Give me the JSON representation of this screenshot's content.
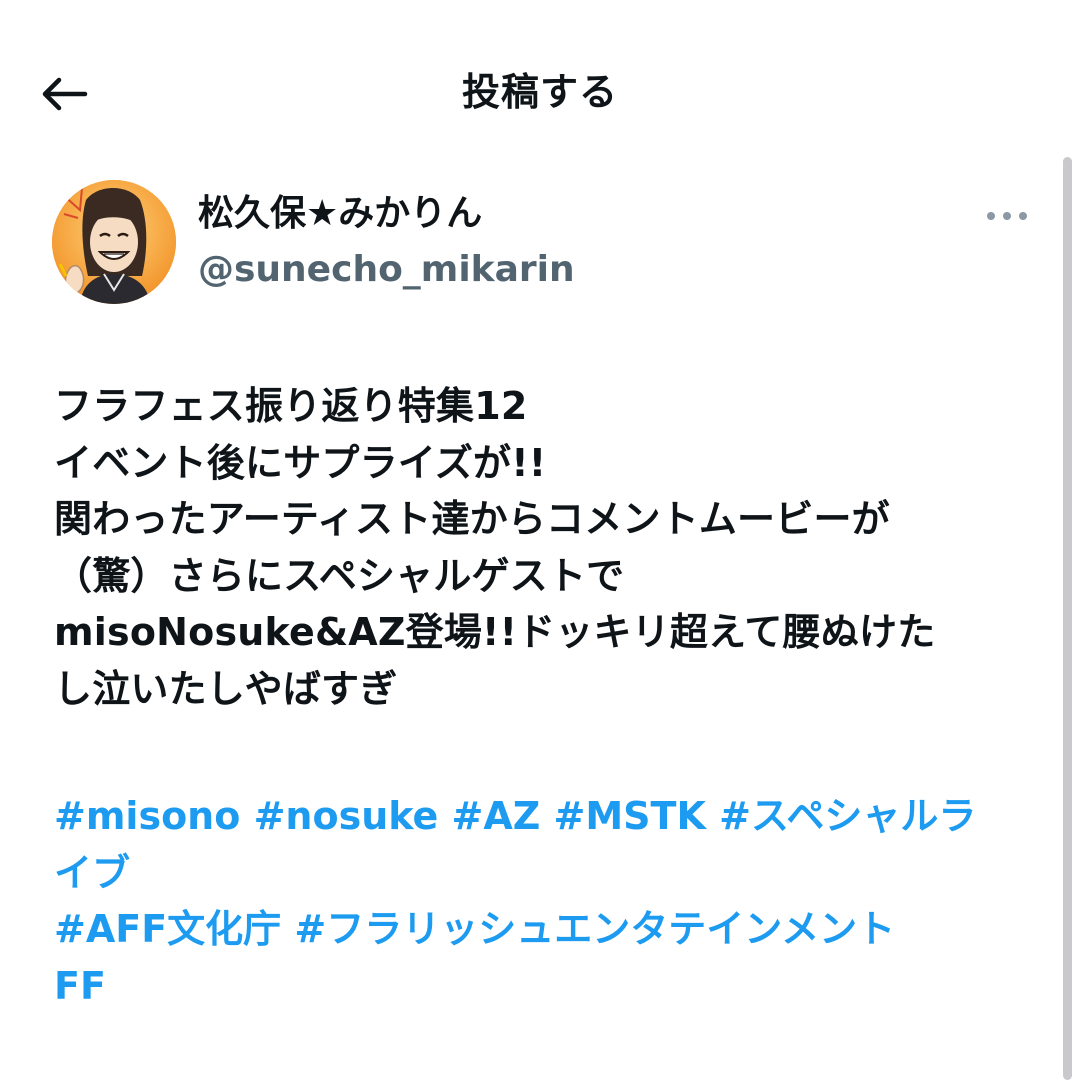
{
  "header": {
    "title": "投稿する",
    "back_icon": "arrow-left-icon"
  },
  "author": {
    "name": "松久保★みかりん",
    "handle": "@sunecho_mikarin",
    "avatar_icon": "user-avatar",
    "more_icon": "more-horizontal-icon"
  },
  "post": {
    "lines": [
      "フラフェス振り返り特集12",
      "イベント後にサプライズが!!",
      "関わったアーティスト達からコメントムービーが",
      "（驚）さらにスペシャルゲストで",
      "misoNosuke&AZ登場!!ドッキリ超えて腰ぬけた",
      "し泣いたしやばすぎ"
    ],
    "hashtag_lines": [
      "#misono #nosuke #AZ #MSTK #スペシャルラ",
      "イブ",
      "#AFF文化庁 #フラリッシュエンタテインメント",
      "FF"
    ]
  },
  "colors": {
    "text": "#0f1419",
    "secondary": "#536471",
    "link": "#1d9bf0",
    "scrollbar": "#c9c9cc"
  }
}
